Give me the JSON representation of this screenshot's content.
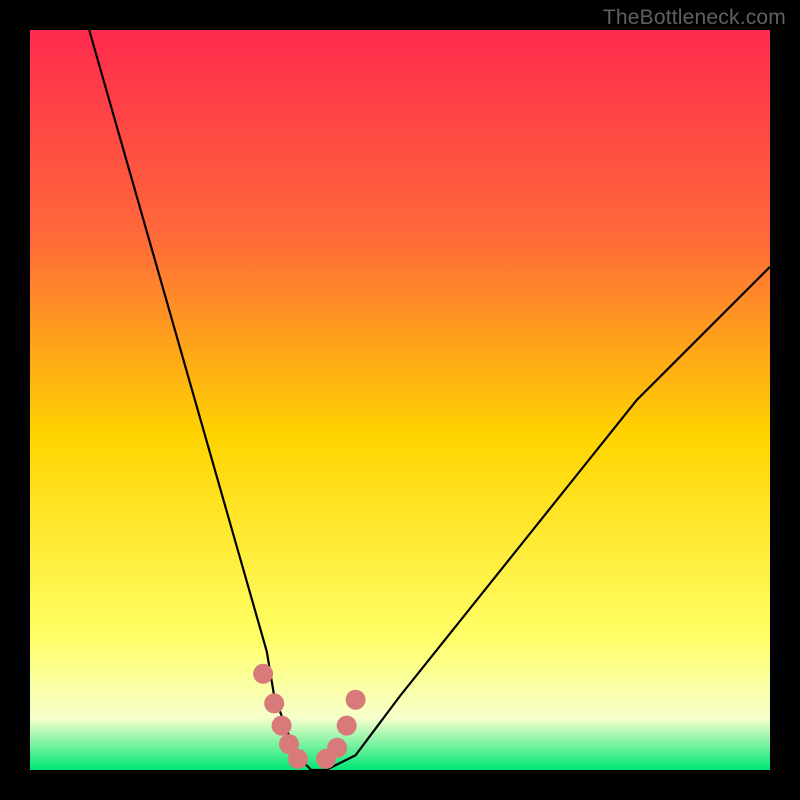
{
  "watermark": "TheBottleneck.com",
  "colors": {
    "background": "#000000",
    "gradient_top": "#ff2a4d",
    "gradient_mid_upper": "#ff6a3a",
    "gradient_mid": "#ffd400",
    "gradient_lower": "#ffff66",
    "gradient_base": "#f7ffcc",
    "gradient_bottom": "#00e676",
    "curve": "#000000",
    "marker": "#d97a7a"
  },
  "chart_data": {
    "type": "line",
    "title": "",
    "xlabel": "",
    "ylabel": "",
    "xlim": [
      0,
      100
    ],
    "ylim": [
      0,
      100
    ],
    "series": [
      {
        "name": "bottleneck-curve",
        "x": [
          8,
          12,
          16,
          20,
          24,
          28,
          32,
          33,
          36,
          38,
          40,
          44,
          50,
          58,
          66,
          74,
          82,
          90,
          98,
          100
        ],
        "y": [
          100,
          86,
          72,
          58,
          44,
          30,
          16,
          10,
          2,
          0,
          0,
          2,
          10,
          20,
          30,
          40,
          50,
          58,
          66,
          68
        ]
      }
    ],
    "markers": {
      "name": "bottom-markers",
      "x": [
        31.5,
        33.0,
        34.0,
        35.0,
        36.2,
        40.0,
        41.5,
        42.8,
        44.0
      ],
      "y": [
        13.0,
        9.0,
        6.0,
        3.5,
        1.5,
        1.5,
        3.0,
        6.0,
        9.5
      ]
    }
  }
}
